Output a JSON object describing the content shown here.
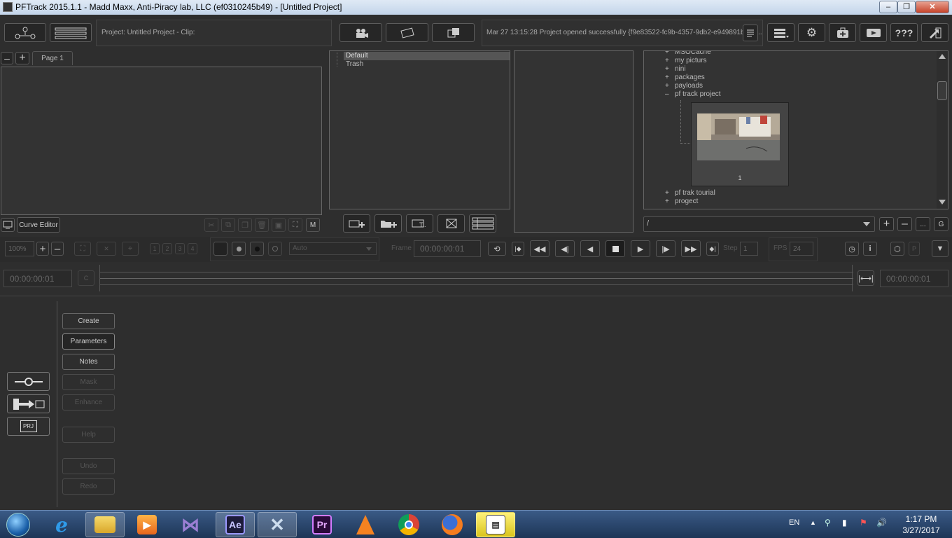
{
  "window": {
    "title": "PFTrack 2015.1.1 - Madd Maxx, Anti-Piracy lab, LLC (ef0310245b49) - [Untitled Project]",
    "min": "–",
    "max": "❐",
    "close": "✕"
  },
  "toolbar": {
    "project_clip": "Project: Untitled Project - Clip:",
    "status_message": "Mar 27 13:15:28 Project opened successfully {f9e83522-fc9b-4357-9db2-e949891bf85 ...",
    "help_label": "???"
  },
  "node_editor": {
    "page_tab": "Page 1",
    "curve_editor": "Curve Editor",
    "m_label": "M"
  },
  "clip_bins": {
    "items": [
      "Default",
      "Trash"
    ]
  },
  "file_browser": {
    "tree": [
      {
        "pm": "+",
        "name": "MSOCache"
      },
      {
        "pm": "+",
        "name": "my picturs"
      },
      {
        "pm": "+",
        "name": "nini"
      },
      {
        "pm": "+",
        "name": "packages"
      },
      {
        "pm": "+",
        "name": "payloads"
      },
      {
        "pm": "–",
        "name": "pf track project"
      }
    ],
    "thumb_label": "1",
    "tree_after": [
      {
        "pm": "+",
        "name": "pf trak tourial"
      },
      {
        "pm": "+",
        "name": "progect"
      }
    ],
    "path": "/",
    "ellipsis": "...",
    "g_label": "G"
  },
  "playback": {
    "zoom": "100%",
    "pages": [
      "1",
      "2",
      "3",
      "4"
    ],
    "mode_select": "Auto",
    "frame_label": "Frame",
    "frame_value": "00:00:00:01",
    "step_label": "Step",
    "step_value": "1",
    "fps_label": "FPS",
    "fps_value": "24",
    "p_label": "P"
  },
  "timeline": {
    "start_time": "00:00:00:01",
    "c_label": "C",
    "end_time": "00:00:00:01"
  },
  "side_panel": {
    "buttons": [
      {
        "label": "Create",
        "state": "enabled"
      },
      {
        "label": "Parameters",
        "state": "selected"
      },
      {
        "label": "Notes",
        "state": "enabled"
      },
      {
        "label": "Mask",
        "state": "disabled"
      },
      {
        "label": "Enhance",
        "state": "disabled"
      },
      {
        "label": "Help",
        "state": "disabled"
      },
      {
        "label": "Undo",
        "state": "disabled"
      },
      {
        "label": "Redo",
        "state": "disabled"
      }
    ],
    "prj_label": "PRJ"
  },
  "taskbar": {
    "apps": [
      "start-orb",
      "internet-explorer",
      "file-explorer",
      "media-player",
      "visual-studio",
      "after-effects",
      "autodesk-app",
      "premiere",
      "vlc",
      "chrome",
      "firefox",
      "pftrack"
    ],
    "ae_label": "Ae",
    "pr_label": "Pr",
    "lang": "EN",
    "time": "1:17 PM",
    "date": "3/27/2017"
  },
  "colors": {
    "background": "#2e2e2e",
    "panel": "#333333",
    "border": "#505050",
    "selection": "#555555",
    "taskbar": "#1d3556"
  }
}
